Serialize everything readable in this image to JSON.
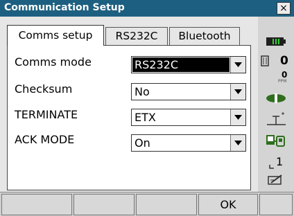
{
  "window": {
    "title": "Communication Setup",
    "close_label": "×"
  },
  "tabs": [
    {
      "label": "Comms setup",
      "active": true
    },
    {
      "label": "RS232C",
      "active": false
    },
    {
      "label": "Bluetooth",
      "active": false
    }
  ],
  "fields": [
    {
      "label": "Comms mode",
      "value": "RS232C",
      "focused": true
    },
    {
      "label": "Checksum",
      "value": "No",
      "focused": false
    },
    {
      "label": "TERMINATE",
      "value": "ETX",
      "focused": false
    },
    {
      "label": "ACK MODE",
      "value": "On",
      "focused": false
    }
  ],
  "status": {
    "battery_icon": "battery-icon",
    "target_value": "0",
    "ppm_value": "0",
    "ppm_unit": "PPM",
    "prism_icon": "prism-icon",
    "tilt_icon": "tilt-icon",
    "device_icon": "device-icon",
    "page_value": "1",
    "input_icon": "pen-input-icon"
  },
  "softkeys": [
    "",
    "",
    "",
    "OK",
    ""
  ],
  "colors": {
    "titlebar": "#1d5f80",
    "sidebar_green": "#2e6e1e"
  }
}
